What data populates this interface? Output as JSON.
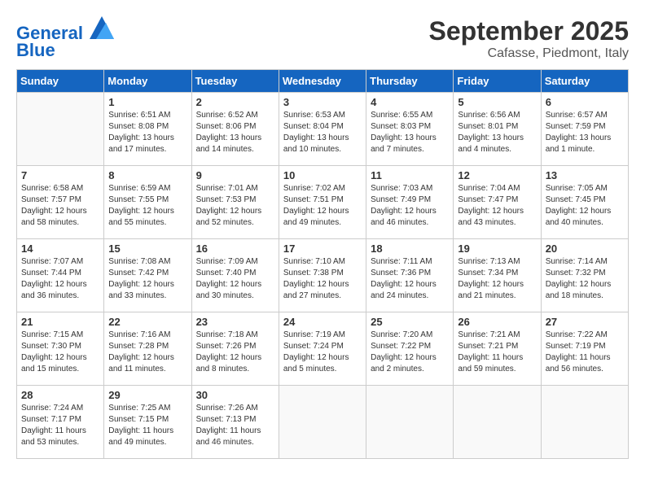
{
  "header": {
    "logo_line1": "General",
    "logo_line2": "Blue",
    "month": "September 2025",
    "location": "Cafasse, Piedmont, Italy"
  },
  "weekdays": [
    "Sunday",
    "Monday",
    "Tuesday",
    "Wednesday",
    "Thursday",
    "Friday",
    "Saturday"
  ],
  "weeks": [
    [
      {
        "day": "",
        "info": ""
      },
      {
        "day": "1",
        "info": "Sunrise: 6:51 AM\nSunset: 8:08 PM\nDaylight: 13 hours\nand 17 minutes."
      },
      {
        "day": "2",
        "info": "Sunrise: 6:52 AM\nSunset: 8:06 PM\nDaylight: 13 hours\nand 14 minutes."
      },
      {
        "day": "3",
        "info": "Sunrise: 6:53 AM\nSunset: 8:04 PM\nDaylight: 13 hours\nand 10 minutes."
      },
      {
        "day": "4",
        "info": "Sunrise: 6:55 AM\nSunset: 8:03 PM\nDaylight: 13 hours\nand 7 minutes."
      },
      {
        "day": "5",
        "info": "Sunrise: 6:56 AM\nSunset: 8:01 PM\nDaylight: 13 hours\nand 4 minutes."
      },
      {
        "day": "6",
        "info": "Sunrise: 6:57 AM\nSunset: 7:59 PM\nDaylight: 13 hours\nand 1 minute."
      }
    ],
    [
      {
        "day": "7",
        "info": "Sunrise: 6:58 AM\nSunset: 7:57 PM\nDaylight: 12 hours\nand 58 minutes."
      },
      {
        "day": "8",
        "info": "Sunrise: 6:59 AM\nSunset: 7:55 PM\nDaylight: 12 hours\nand 55 minutes."
      },
      {
        "day": "9",
        "info": "Sunrise: 7:01 AM\nSunset: 7:53 PM\nDaylight: 12 hours\nand 52 minutes."
      },
      {
        "day": "10",
        "info": "Sunrise: 7:02 AM\nSunset: 7:51 PM\nDaylight: 12 hours\nand 49 minutes."
      },
      {
        "day": "11",
        "info": "Sunrise: 7:03 AM\nSunset: 7:49 PM\nDaylight: 12 hours\nand 46 minutes."
      },
      {
        "day": "12",
        "info": "Sunrise: 7:04 AM\nSunset: 7:47 PM\nDaylight: 12 hours\nand 43 minutes."
      },
      {
        "day": "13",
        "info": "Sunrise: 7:05 AM\nSunset: 7:45 PM\nDaylight: 12 hours\nand 40 minutes."
      }
    ],
    [
      {
        "day": "14",
        "info": "Sunrise: 7:07 AM\nSunset: 7:44 PM\nDaylight: 12 hours\nand 36 minutes."
      },
      {
        "day": "15",
        "info": "Sunrise: 7:08 AM\nSunset: 7:42 PM\nDaylight: 12 hours\nand 33 minutes."
      },
      {
        "day": "16",
        "info": "Sunrise: 7:09 AM\nSunset: 7:40 PM\nDaylight: 12 hours\nand 30 minutes."
      },
      {
        "day": "17",
        "info": "Sunrise: 7:10 AM\nSunset: 7:38 PM\nDaylight: 12 hours\nand 27 minutes."
      },
      {
        "day": "18",
        "info": "Sunrise: 7:11 AM\nSunset: 7:36 PM\nDaylight: 12 hours\nand 24 minutes."
      },
      {
        "day": "19",
        "info": "Sunrise: 7:13 AM\nSunset: 7:34 PM\nDaylight: 12 hours\nand 21 minutes."
      },
      {
        "day": "20",
        "info": "Sunrise: 7:14 AM\nSunset: 7:32 PM\nDaylight: 12 hours\nand 18 minutes."
      }
    ],
    [
      {
        "day": "21",
        "info": "Sunrise: 7:15 AM\nSunset: 7:30 PM\nDaylight: 12 hours\nand 15 minutes."
      },
      {
        "day": "22",
        "info": "Sunrise: 7:16 AM\nSunset: 7:28 PM\nDaylight: 12 hours\nand 11 minutes."
      },
      {
        "day": "23",
        "info": "Sunrise: 7:18 AM\nSunset: 7:26 PM\nDaylight: 12 hours\nand 8 minutes."
      },
      {
        "day": "24",
        "info": "Sunrise: 7:19 AM\nSunset: 7:24 PM\nDaylight: 12 hours\nand 5 minutes."
      },
      {
        "day": "25",
        "info": "Sunrise: 7:20 AM\nSunset: 7:22 PM\nDaylight: 12 hours\nand 2 minutes."
      },
      {
        "day": "26",
        "info": "Sunrise: 7:21 AM\nSunset: 7:21 PM\nDaylight: 11 hours\nand 59 minutes."
      },
      {
        "day": "27",
        "info": "Sunrise: 7:22 AM\nSunset: 7:19 PM\nDaylight: 11 hours\nand 56 minutes."
      }
    ],
    [
      {
        "day": "28",
        "info": "Sunrise: 7:24 AM\nSunset: 7:17 PM\nDaylight: 11 hours\nand 53 minutes."
      },
      {
        "day": "29",
        "info": "Sunrise: 7:25 AM\nSunset: 7:15 PM\nDaylight: 11 hours\nand 49 minutes."
      },
      {
        "day": "30",
        "info": "Sunrise: 7:26 AM\nSunset: 7:13 PM\nDaylight: 11 hours\nand 46 minutes."
      },
      {
        "day": "",
        "info": ""
      },
      {
        "day": "",
        "info": ""
      },
      {
        "day": "",
        "info": ""
      },
      {
        "day": "",
        "info": ""
      }
    ]
  ]
}
